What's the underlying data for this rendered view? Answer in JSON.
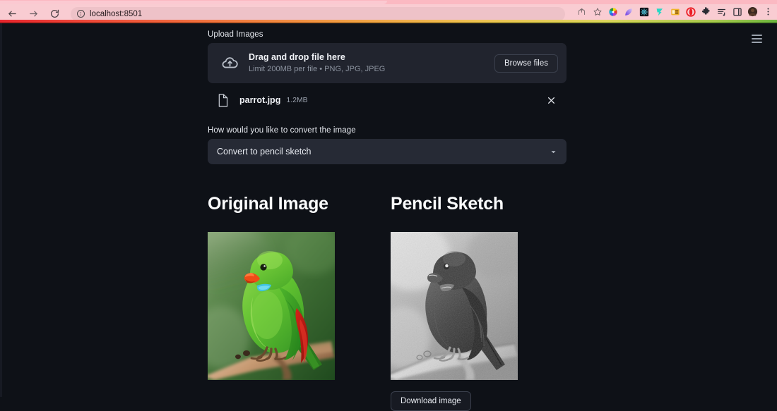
{
  "browser": {
    "url": "localhost:8501",
    "back_label": "Back",
    "forward_label": "Forward",
    "reload_label": "Reload",
    "site_info_label": "site-information",
    "share_label": "Share this page",
    "bookmark_label": "Bookmark this tab",
    "extension_icons": [
      "color-wheel-extension-icon",
      "purple-gradient-extension-icon",
      "dark-grid-extension-icon",
      "teal-bird-extension-icon",
      "yellow-panel-extension-icon",
      "opera-red-extension-icon",
      "puzzle-extensions-icon",
      "reading-list-icon",
      "side-panel-icon"
    ],
    "profile_label": "Profile",
    "menu_label": "Customize and control Chrome"
  },
  "app": {
    "menu_label": "Main menu",
    "uploader": {
      "label": "Upload Images",
      "drop_title": "Drag and drop file here",
      "drop_subtitle": "Limit 200MB per file • PNG, JPG, JPEG",
      "browse_label": "Browse files",
      "cloud_icon": "cloud-upload-icon",
      "file": {
        "icon": "document-icon",
        "name": "parrot.jpg",
        "size": "1.2MB",
        "remove_icon": "close-icon"
      }
    },
    "converter": {
      "label": "How would you like to convert the image",
      "selected": "Convert to pencil sketch",
      "caret_icon": "chevron-down-icon",
      "options": [
        "Convert to pencil sketch"
      ]
    },
    "results": {
      "original": {
        "title": "Original Image",
        "image_alt": "green parrot perched on a branch"
      },
      "sketch": {
        "title": "Pencil Sketch",
        "image_alt": "pencil sketch of a parrot perched on a branch",
        "download_label": "Download image"
      }
    }
  },
  "colors": {
    "app_background": "#0e1117",
    "panel": "#21242e",
    "select": "#262a35",
    "text_primary": "#fafbfc",
    "text_muted": "#8b929e",
    "chrome_pink": "#f9ccd2",
    "accent_bar_start": "#e8262e",
    "accent_bar_end": "#6fb73f"
  }
}
